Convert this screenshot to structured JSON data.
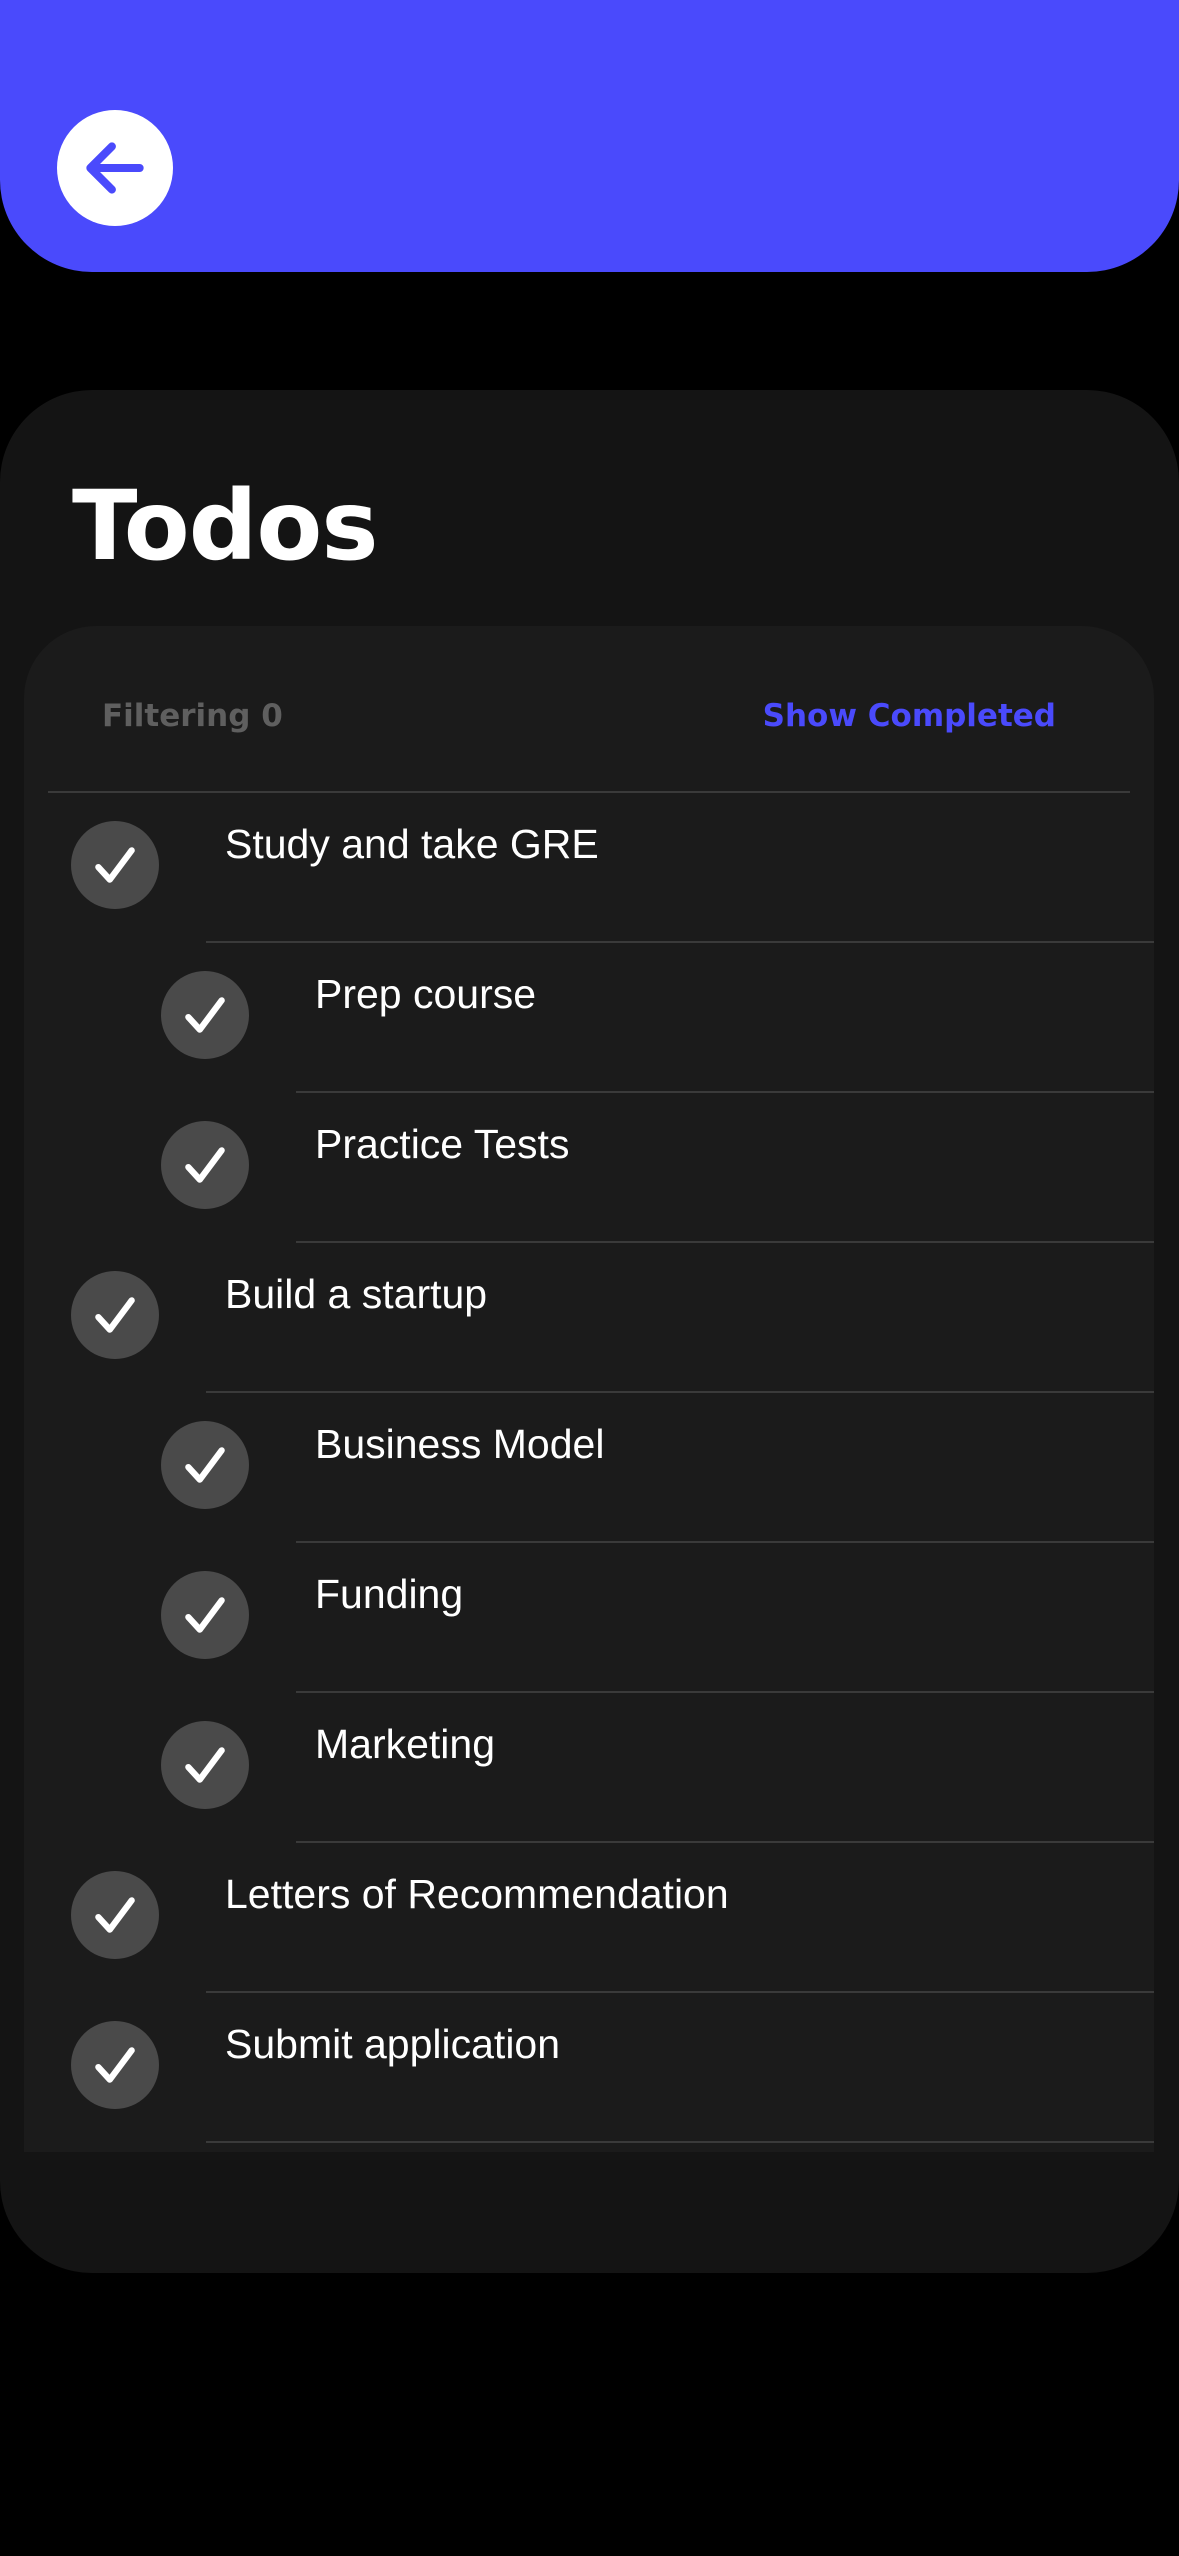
{
  "header": {
    "back_icon": "arrow-left-icon",
    "accent_color": "#4a4afc"
  },
  "title": "Todos",
  "filter": {
    "label": "Filtering 0",
    "show_completed_label": "Show Completed"
  },
  "todos": [
    {
      "label": "Study and take GRE",
      "level": 0,
      "completed": true
    },
    {
      "label": "Prep course",
      "level": 1,
      "completed": true
    },
    {
      "label": "Practice Tests",
      "level": 1,
      "completed": true
    },
    {
      "label": "Build a startup",
      "level": 0,
      "completed": true
    },
    {
      "label": "Business Model",
      "level": 1,
      "completed": true
    },
    {
      "label": "Funding",
      "level": 1,
      "completed": true
    },
    {
      "label": "Marketing",
      "level": 1,
      "completed": true
    },
    {
      "label": "Letters of Recommendation",
      "level": 0,
      "completed": true
    },
    {
      "label": "Submit application",
      "level": 0,
      "completed": true
    }
  ]
}
